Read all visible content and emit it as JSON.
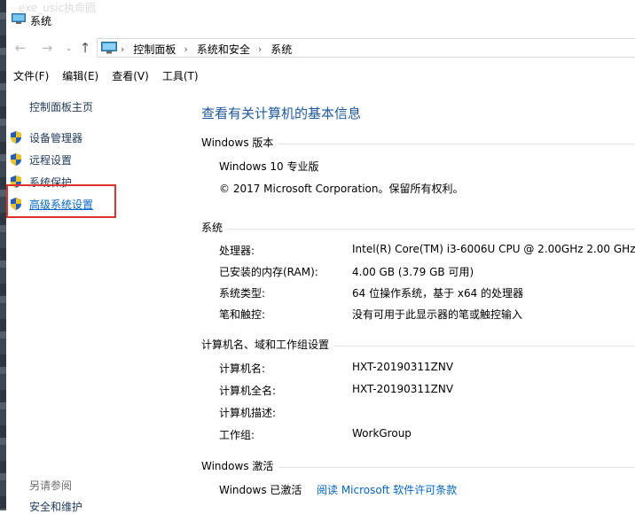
{
  "window": {
    "title": "系统",
    "ghost_text": "exe_usic执命圆"
  },
  "nav": {
    "back_glyph": "←",
    "forward_glyph": "→",
    "up_glyph": "↑",
    "chevron_glyph": "⌄"
  },
  "address": {
    "crumbs": [
      "控制面板",
      "系统和安全",
      "系统"
    ],
    "separator": "›"
  },
  "menu": [
    "文件(F)",
    "编辑(E)",
    "查看(V)",
    "工具(T)"
  ],
  "left": {
    "home": "控制面板主页",
    "tasks": [
      "设备管理器",
      "远程设置",
      "系统保护",
      "高级系统设置"
    ],
    "see_also_title": "另请参阅",
    "see_also_items": [
      "安全和维护"
    ]
  },
  "main": {
    "heading": "查看有关计算机的基本信息",
    "windows_edition": {
      "title": "Windows 版本",
      "edition": "Windows 10 专业版",
      "copyright": "© 2017 Microsoft Corporation。保留所有权利。"
    },
    "system": {
      "title": "系统",
      "rows": [
        {
          "label": "处理器:",
          "value": "Intel(R) Core(TM) i3-6006U CPU @ 2.00GHz   2.00 GHz"
        },
        {
          "label": "已安装的内存(RAM):",
          "value": "4.00 GB (3.79 GB 可用)"
        },
        {
          "label": "系统类型:",
          "value": "64 位操作系统，基于 x64 的处理器"
        },
        {
          "label": "笔和触控:",
          "value": "没有可用于此显示器的笔或触控输入"
        }
      ]
    },
    "computer": {
      "title": "计算机名、域和工作组设置",
      "rows": [
        {
          "label": "计算机名:",
          "value": "HXT-20190311ZNV"
        },
        {
          "label": "计算机全名:",
          "value": "HXT-20190311ZNV"
        },
        {
          "label": "计算机描述:",
          "value": ""
        },
        {
          "label": "工作组:",
          "value": "WorkGroup"
        }
      ]
    },
    "activation": {
      "title": "Windows 激活",
      "status": "Windows 已激活",
      "license_link": "阅读 Microsoft 软件许可条款"
    }
  },
  "colors": {
    "heading": "#1e5aa0",
    "link": "#0066cc",
    "highlight_box": "#e0322c"
  }
}
